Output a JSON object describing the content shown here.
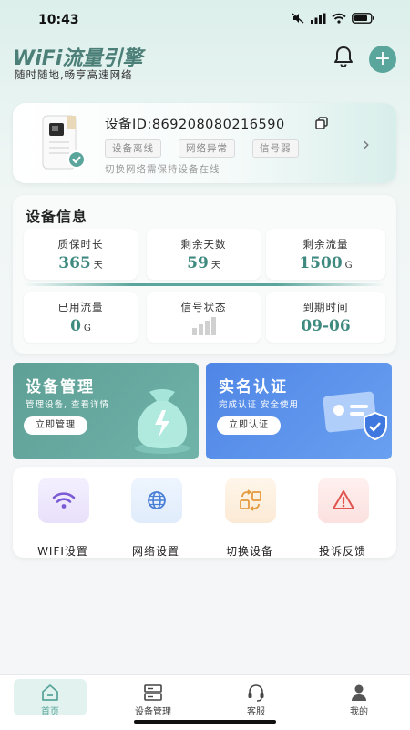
{
  "status_bar": {
    "time": "10:43"
  },
  "header": {
    "title": "WiFi流量引擎",
    "subtitle": "随时随地,畅享高速网络"
  },
  "device": {
    "id_label": "设备ID:",
    "id_value": "869208080216590",
    "tags": [
      "设备离线",
      "网络异常",
      "信号弱"
    ],
    "hint": "切换网络需保持设备在线"
  },
  "device_info": {
    "title": "设备信息",
    "cells": [
      {
        "label": "质保时长",
        "value": "365",
        "unit": "天"
      },
      {
        "label": "剩余天数",
        "value": "59",
        "unit": "天"
      },
      {
        "label": "剩余流量",
        "value": "1500",
        "unit": "G"
      },
      {
        "label": "已用流量",
        "value": "0",
        "unit": "G"
      },
      {
        "label": "信号状态",
        "value": "",
        "unit": ""
      },
      {
        "label": "到期时间",
        "value": "09-06",
        "unit": ""
      }
    ]
  },
  "banners": [
    {
      "title": "设备管理",
      "subtitle": "管理设备, 查看详情",
      "button": "立即管理",
      "color": "#62a79d"
    },
    {
      "title": "实名认证",
      "subtitle": "完成认证 安全使用",
      "button": "立即认证",
      "color": "#5b8ee6"
    }
  ],
  "shortcuts": [
    {
      "label": "WIFI设置",
      "icon": "wifi-icon"
    },
    {
      "label": "网络设置",
      "icon": "globe-icon"
    },
    {
      "label": "切换设备",
      "icon": "switch-icon"
    },
    {
      "label": "投诉反馈",
      "icon": "warning-icon"
    }
  ],
  "bottom_nav": [
    {
      "label": "首页",
      "icon": "home-icon",
      "active": true
    },
    {
      "label": "设备管理",
      "icon": "device-icon"
    },
    {
      "label": "客服",
      "icon": "headset-icon"
    },
    {
      "label": "我的",
      "icon": "user-icon"
    }
  ],
  "colors": {
    "accent": "#5aa69c",
    "value_text": "#3f8a80",
    "blue_banner": "#5b8ee6"
  }
}
